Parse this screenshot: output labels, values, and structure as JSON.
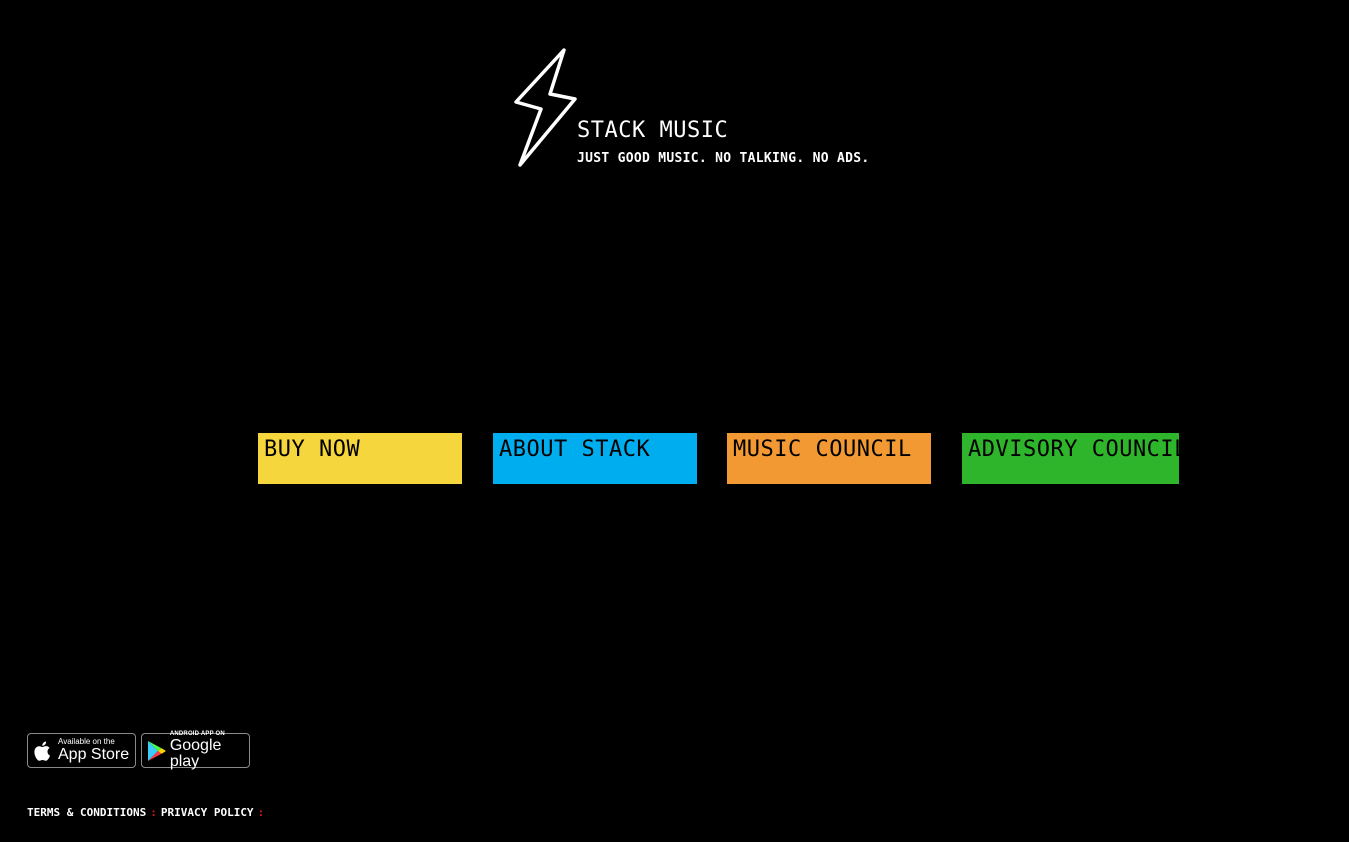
{
  "brand": {
    "title": "STACK MUSIC",
    "tagline": "JUST GOOD MUSIC. NO TALKING. NO ADS.",
    "logo_icon": "lightning-bolt-icon"
  },
  "nav": {
    "tiles": [
      {
        "label": "BUY NOW",
        "color": "#f5d63d"
      },
      {
        "label": "ABOUT STACK",
        "color": "#00aeef"
      },
      {
        "label": "MUSIC COUNCIL",
        "color": "#f29933"
      },
      {
        "label": "ADVISORY COUNCIL",
        "color": "#2fb52b"
      }
    ]
  },
  "badges": {
    "appstore": {
      "small": "Available on the",
      "big": "App Store",
      "icon": "apple-icon"
    },
    "google": {
      "small": "ANDROID APP ON",
      "big": "Google play",
      "icon": "google-play-icon"
    }
  },
  "footer": {
    "terms": "TERMS & CONDITIONS",
    "privacy": "PRIVACY POLICY",
    "separator": ":",
    "separator_color": "#d11b1b"
  },
  "colors": {
    "background": "#000000",
    "text": "#ffffff"
  }
}
